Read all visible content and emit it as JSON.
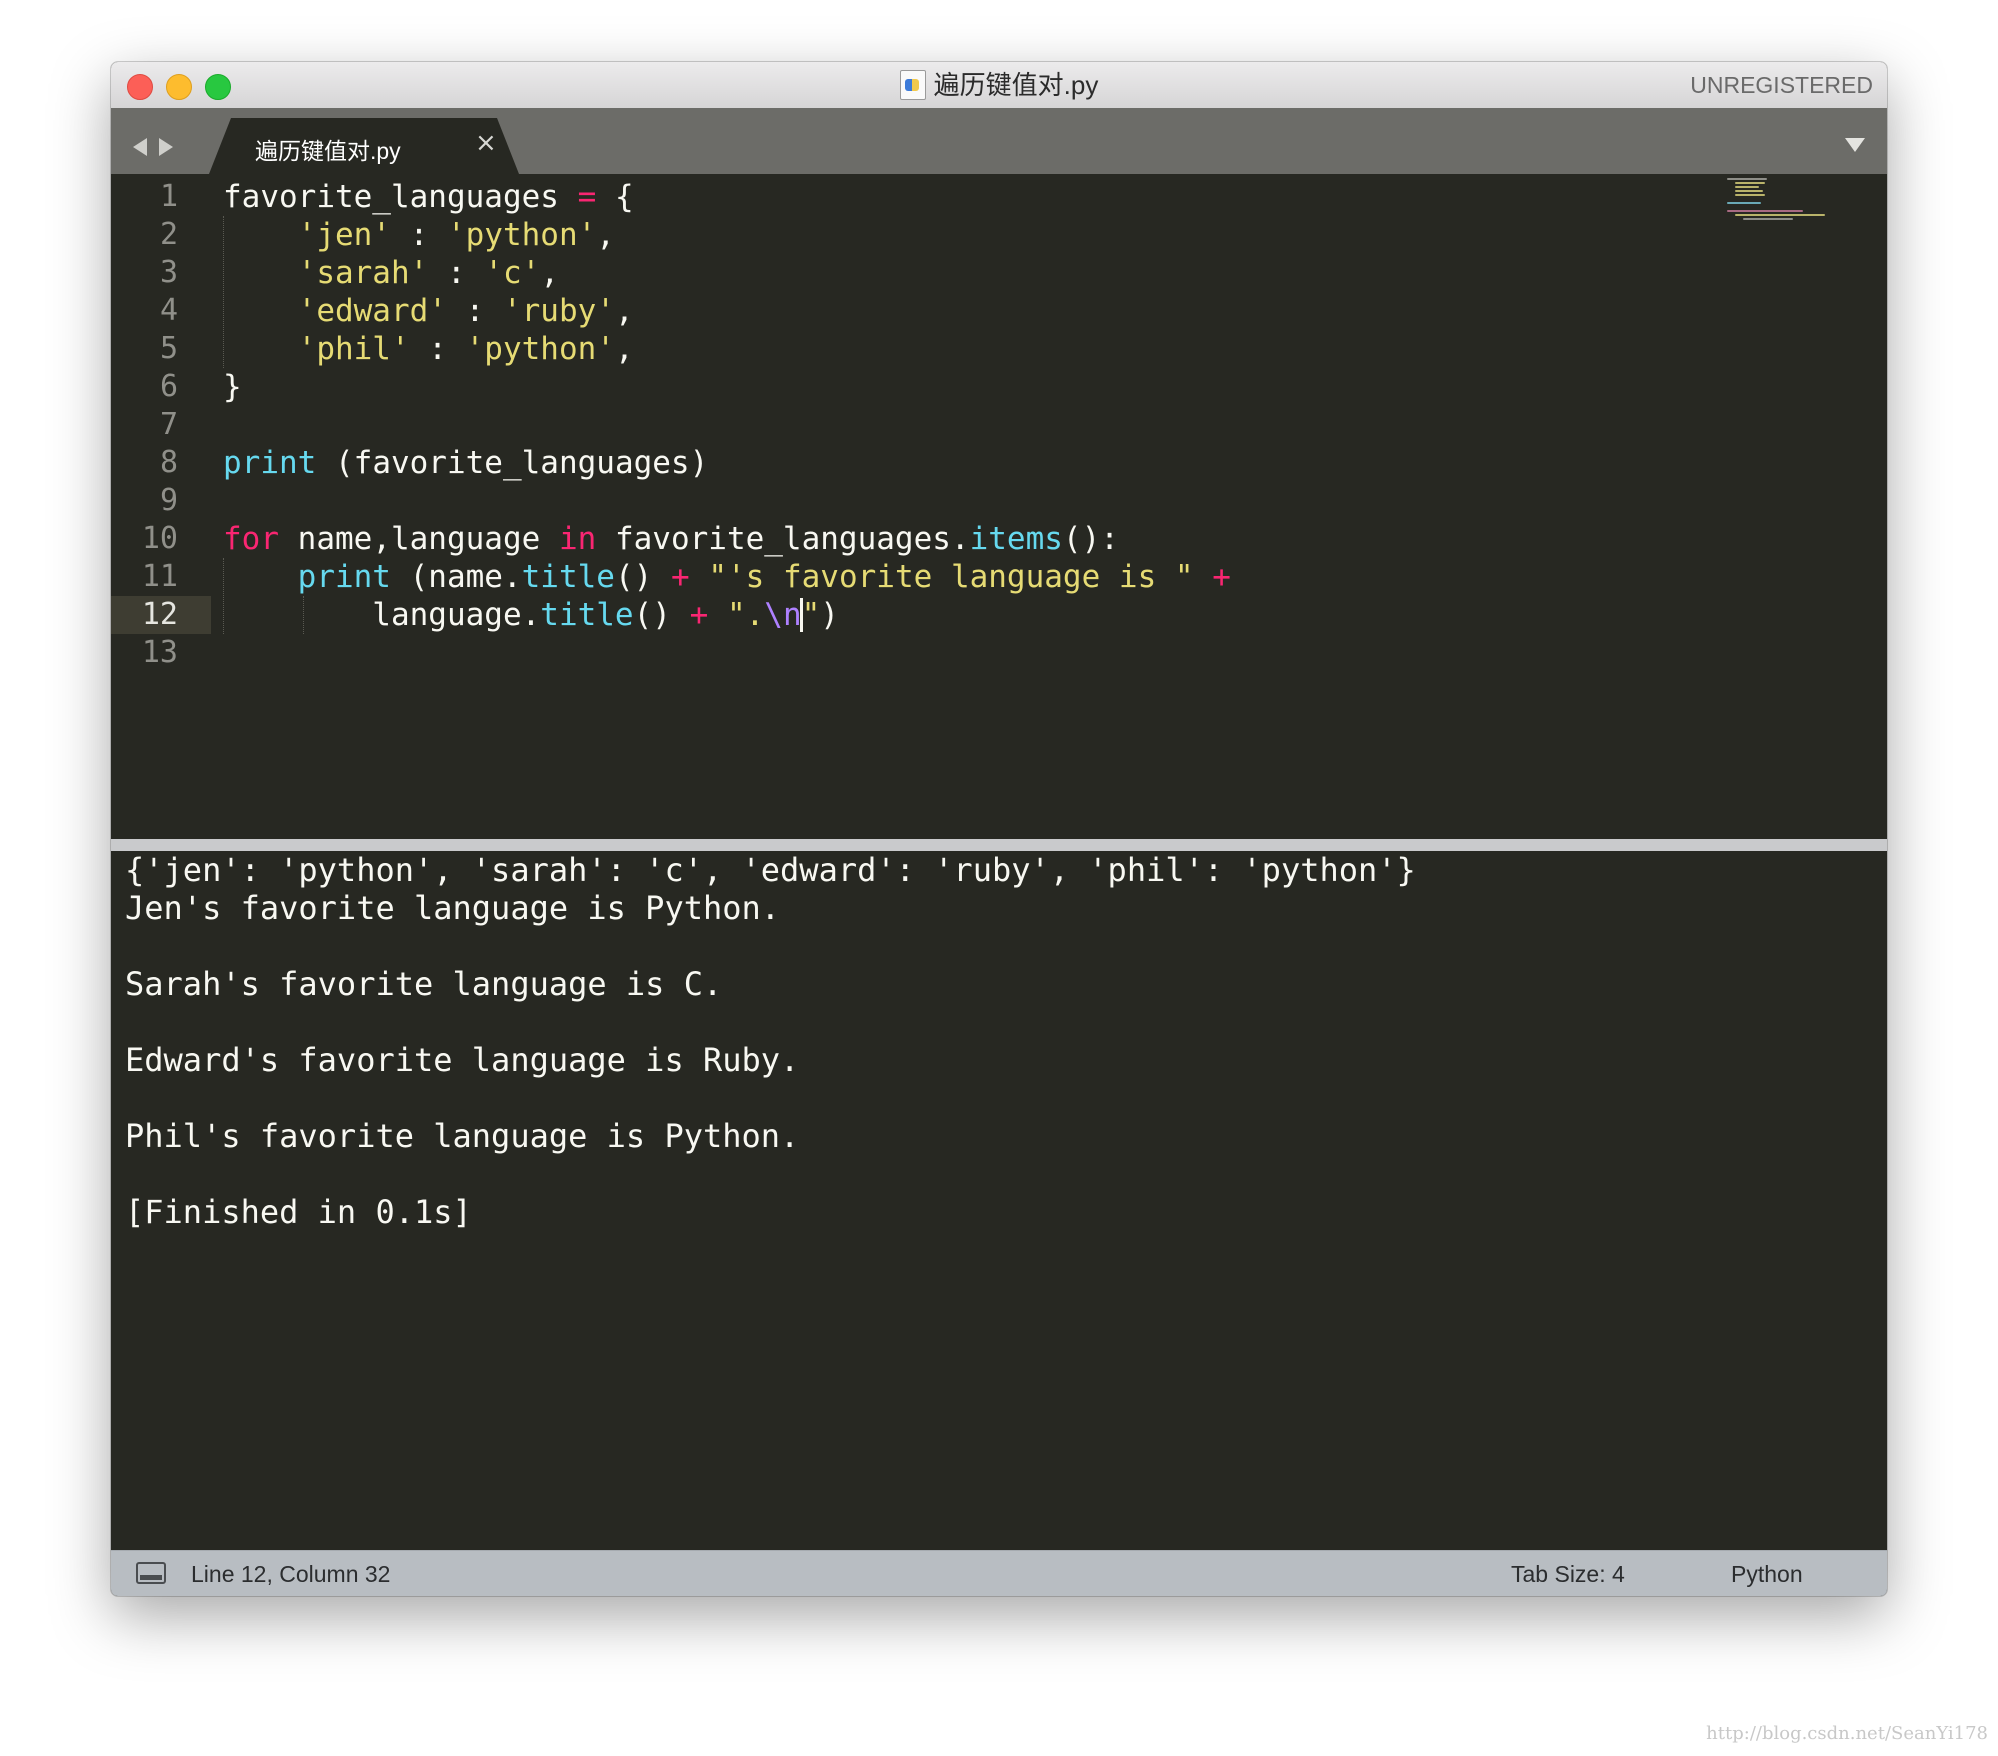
{
  "window": {
    "title": "遍历键值对.py",
    "registration_status": "UNREGISTERED"
  },
  "tabs": [
    {
      "label": "遍历键值对.py",
      "close_glyph": "×"
    }
  ],
  "editor": {
    "line_numbers": [
      "1",
      "2",
      "3",
      "4",
      "5",
      "6",
      "7",
      "8",
      "9",
      "10",
      "11",
      "12",
      "13"
    ],
    "active_line": "12"
  },
  "output": {
    "lines": [
      "{'jen': 'python', 'sarah': 'c', 'edward': 'ruby', 'phil': 'python'}",
      "Jen's favorite language is Python.",
      "",
      "Sarah's favorite language is C.",
      "",
      "Edward's favorite language is Ruby.",
      "",
      "Phil's favorite language is Python.",
      "",
      "[Finished in 0.1s]"
    ]
  },
  "status_bar": {
    "position": "Line 12, Column 32",
    "tab_size": "Tab Size: 4",
    "syntax": "Python"
  },
  "watermark": "http://blog.csdn.net/SeanYi178",
  "colors": {
    "background": "#272822",
    "keyword": "#f92672",
    "string": "#e6db74",
    "function": "#66d9ef",
    "escape": "#ae81ff",
    "text": "#f8f8f2"
  }
}
